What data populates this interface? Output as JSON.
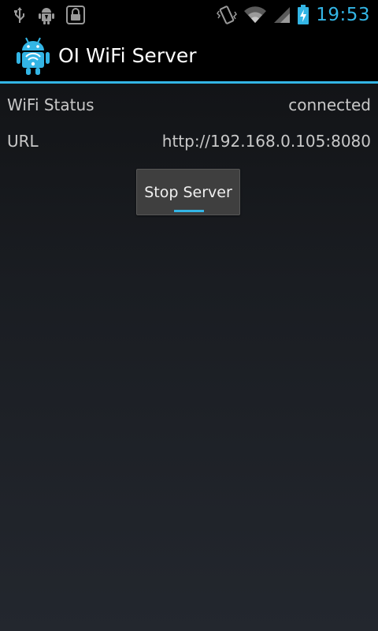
{
  "statusbar": {
    "time": "19:53",
    "left_icons": [
      "usb-icon",
      "android-debug-icon",
      "lock-icon"
    ],
    "right_icons": [
      "vibrate-icon",
      "wifi-icon",
      "signal-icon",
      "battery-charging-icon"
    ]
  },
  "actionbar": {
    "title": "OI WiFi Server",
    "icon": "android-wifi-icon"
  },
  "info": {
    "wifi_status_label": "WiFi Status",
    "wifi_status_value": "connected",
    "url_label": "URL",
    "url_value": "http://192.168.0.105:8080"
  },
  "actions": {
    "stop_server_label": "Stop Server"
  },
  "colors": {
    "accent": "#33b5e5"
  }
}
